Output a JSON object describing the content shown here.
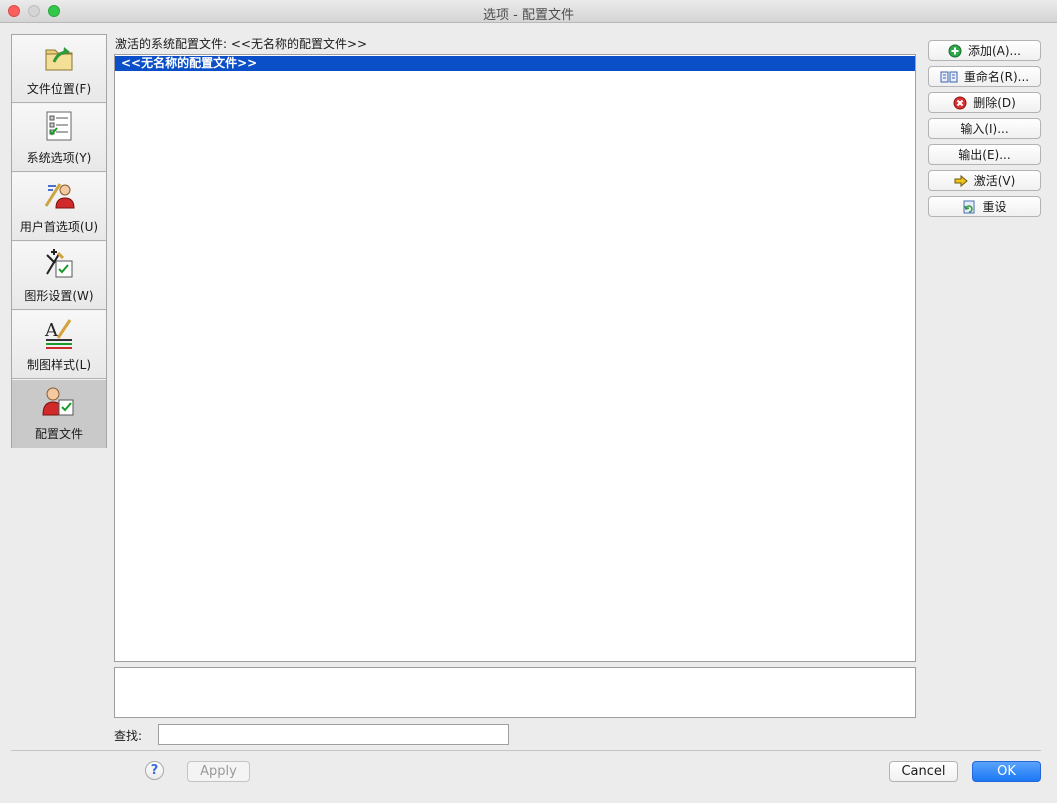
{
  "window": {
    "title": "选项 - 配置文件"
  },
  "sidebar": {
    "items": [
      {
        "label": "文件位置(F)",
        "icon": "folder-arrow-icon",
        "active": false
      },
      {
        "label": "系统选项(Y)",
        "icon": "checklist-icon",
        "active": false
      },
      {
        "label": "用户首选项(U)",
        "icon": "user-preferences-icon",
        "active": false
      },
      {
        "label": "图形设置(W)",
        "icon": "graphics-settings-icon",
        "active": false
      },
      {
        "label": "制图样式(L)",
        "icon": "drafting-style-icon",
        "active": false
      },
      {
        "label": "配置文件",
        "icon": "profile-user-icon",
        "active": true
      }
    ]
  },
  "main": {
    "active_profile_label": "激活的系统配置文件:  <<无名称的配置文件>>",
    "profiles": [
      "<<无名称的配置文件>>"
    ],
    "search_label": "查找:",
    "search_value": ""
  },
  "buttons": {
    "add": "添加(A)...",
    "rename": "重命名(R)...",
    "delete": "删除(D)",
    "import": "输入(I)...",
    "export": "输出(E)...",
    "activate": "激活(V)",
    "reset": "重设"
  },
  "footer": {
    "help": "?",
    "apply": "Apply",
    "cancel": "Cancel",
    "ok": "OK"
  },
  "colors": {
    "selection": "#0b4fc8",
    "ok_button": "#1b78f5"
  }
}
